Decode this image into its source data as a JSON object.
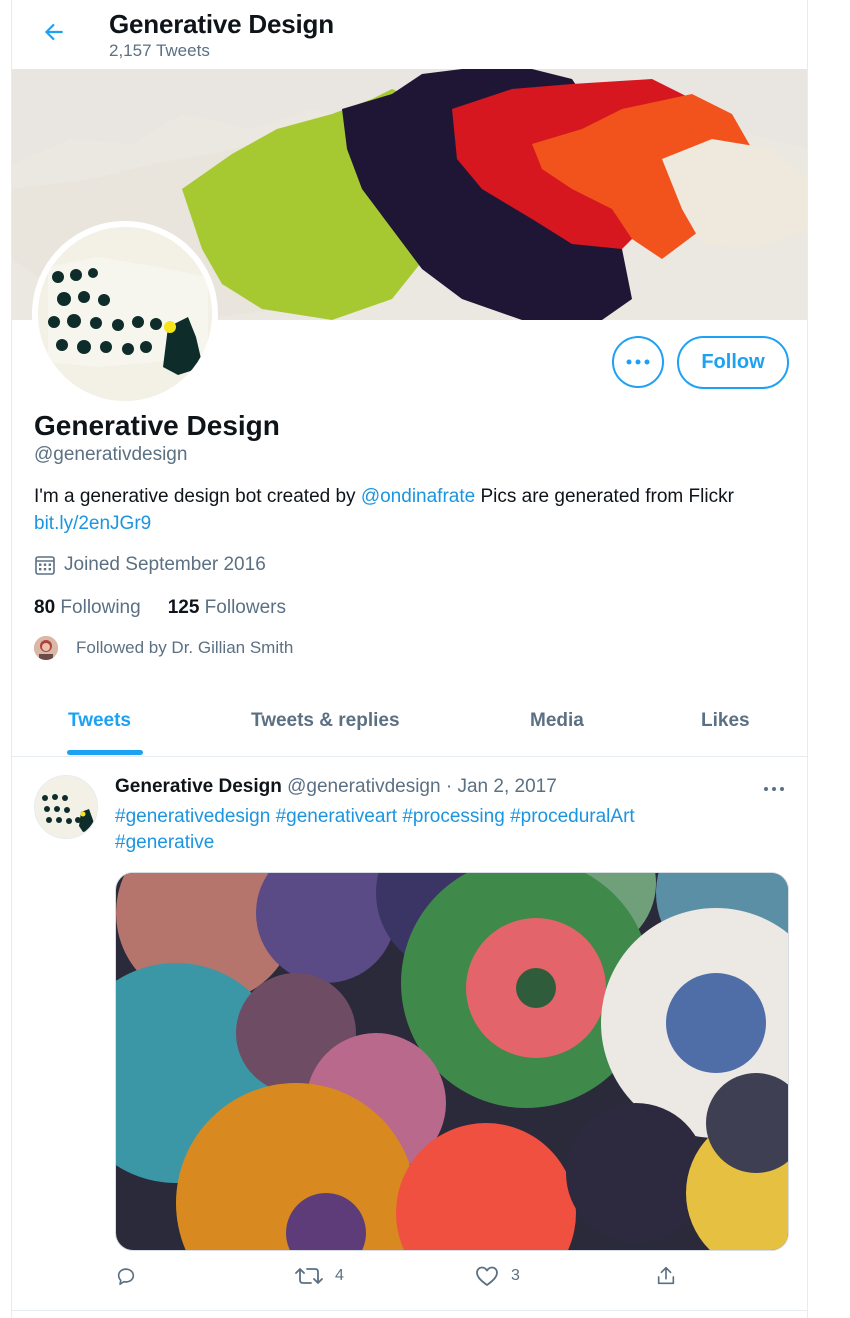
{
  "header": {
    "title": "Generative Design",
    "tweet_count": "2,157 Tweets"
  },
  "profile": {
    "name": "Generative Design",
    "handle": "@generativdesign",
    "bio_part1": "I'm a generative design bot created by ",
    "bio_mention": "@ondinafrate",
    "bio_part2": " Pics are generated from Flickr ",
    "bio_link": "bit.ly/2enJGr9",
    "joined": "Joined September 2016",
    "following_count": "80",
    "following_label": "Following",
    "followers_count": "125",
    "followers_label": "Followers",
    "followed_by": "Followed by Dr. Gillian Smith",
    "follow_label": "Follow"
  },
  "tabs": [
    {
      "label": "Tweets",
      "active": true
    },
    {
      "label": "Tweets & replies",
      "active": false
    },
    {
      "label": "Media",
      "active": false
    },
    {
      "label": "Likes",
      "active": false
    }
  ],
  "tweet": {
    "author": "Generative Design",
    "handle": "@generativdesign",
    "sep": " · ",
    "date": "Jan 2, 2017",
    "hashtags_line1": [
      "#generativedesign",
      "#generativeart",
      "#processing",
      "#proceduralArt"
    ],
    "hashtags_line2": [
      "#generative"
    ],
    "retweets": "4",
    "likes": "3"
  },
  "icons": {
    "back": "arrow-left-icon",
    "more": "more-icon",
    "calendar": "calendar-icon",
    "reply": "reply-icon",
    "retweet": "retweet-icon",
    "like": "heart-icon",
    "share": "share-icon"
  },
  "colors": {
    "accent": "#1da1f2",
    "link": "#1b95e0",
    "secondary_text": "#5b7083"
  }
}
